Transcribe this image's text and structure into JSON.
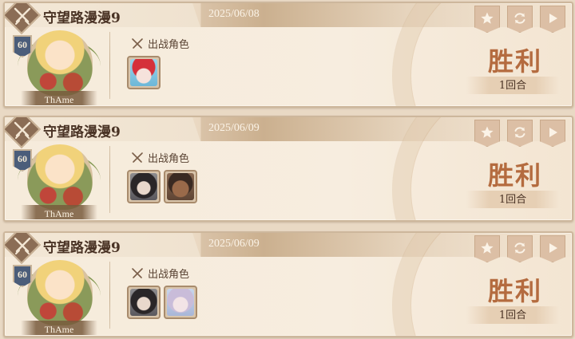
{
  "records": [
    {
      "player": "守望路漫漫9",
      "date": "2025/06/08",
      "level": "60",
      "nickname": "ThAme",
      "team_label": "出战角色",
      "characters": [
        "santa-girl-portrait"
      ],
      "result": "胜利",
      "rounds": "1回合"
    },
    {
      "player": "守望路漫漫9",
      "date": "2025/06/09",
      "level": "60",
      "nickname": "ThAme",
      "team_label": "出战角色",
      "characters": [
        "dark-hair-girl-portrait",
        "bearded-man-portrait"
      ],
      "result": "胜利",
      "rounds": "1回合"
    },
    {
      "player": "守望路漫漫9",
      "date": "2025/06/09",
      "level": "60",
      "nickname": "ThAme",
      "team_label": "出战角色",
      "characters": [
        "dark-hair-girl-portrait",
        "silver-hair-portrait"
      ],
      "result": "胜利",
      "rounds": "1回合"
    }
  ],
  "actions": [
    "star-icon",
    "replay-icon",
    "play-icon"
  ],
  "colors": {
    "result": "#b46b3f",
    "title": "#4a3325",
    "accent": "#dcbfa5"
  }
}
